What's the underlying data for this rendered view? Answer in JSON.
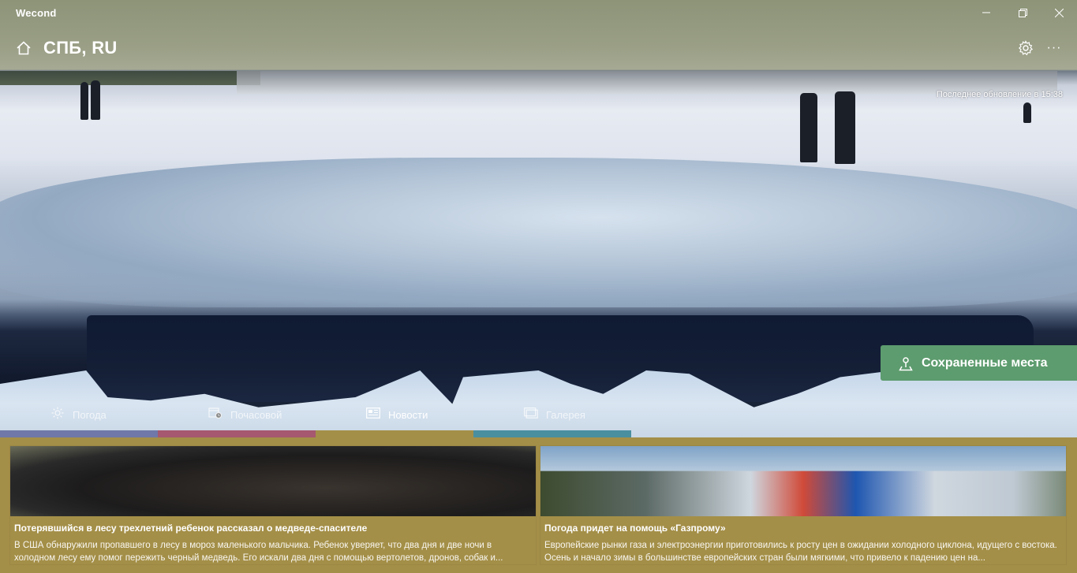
{
  "app": {
    "name": "Wecond"
  },
  "window": {
    "minimize": "—",
    "maximize": "❐",
    "close": "✕"
  },
  "header": {
    "city": "СПБ, RU",
    "settings_icon": "gear-icon",
    "more_icon": "ellipsis-icon",
    "more_label": "···"
  },
  "hero": {
    "last_update": "Последнее обновление в 15:38"
  },
  "saved_places": {
    "label": "Сохраненные места"
  },
  "tabs": [
    {
      "label": "Погода",
      "icon": "sun-icon",
      "color": "#6f78a8"
    },
    {
      "label": "Почасовой",
      "icon": "calendar-clock-icon",
      "color": "#a5586f"
    },
    {
      "label": "Новости",
      "icon": "newspaper-icon",
      "color": "#a48f48",
      "active": true
    },
    {
      "label": "Галерея",
      "icon": "gallery-icon",
      "color": "#4a8fa0"
    }
  ],
  "news": [
    {
      "title": "Потерявшийся в лесу трехлетний ребенок рассказал о медведе-спасителе",
      "text": "В США обнаружили пропавшего в лесу в мороз маленького мальчика. Ребенок уверяет, что два дня и две ночи в холодном лесу ему помог пережить черный медведь. Его искали два дня с помощью вертолетов, дронов, собак и..."
    },
    {
      "title": "Погода придет на помощь «Газпрому»",
      "text": "Европейские рынки газа и электроэнергии приготовились к росту цен в ожидании холодного циклона, идущего с востока. Осень и начало зимы в большинстве европейских стран были мягкими, что привело к падению цен на..."
    }
  ],
  "colors": {
    "accent": "#a48f48",
    "saved": "#5d9c6e"
  }
}
